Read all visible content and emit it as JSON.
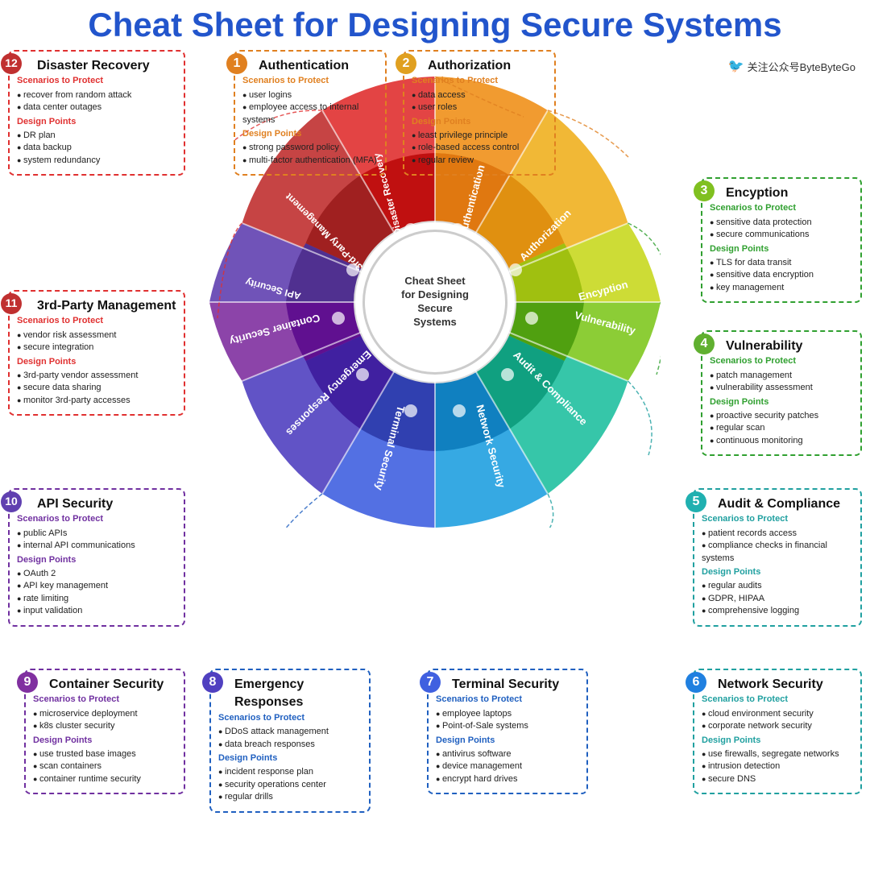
{
  "title": {
    "text": "Cheat Sheet for Designing Secure Systems",
    "brand": "关注公众号ByteByteGo"
  },
  "center": {
    "text": "Cheat Sheet\nfor Designing\nSecure\nSystems"
  },
  "sections": {
    "s1": {
      "num": "1",
      "title": "Authentication",
      "scenarios_label": "Scenarios to Protect",
      "scenarios": [
        "user logins",
        "employee access to internal systems"
      ],
      "design_label": "Design Points",
      "design": [
        "strong password policy",
        "multi-factor authentication (MFA)"
      ]
    },
    "s2": {
      "num": "2",
      "title": "Authorization",
      "scenarios_label": "Scenarios to Protect",
      "scenarios": [
        "data access",
        "user roles"
      ],
      "design_label": "Design Points",
      "design": [
        "least privilege principle",
        "role-based access control",
        "regular review"
      ]
    },
    "s3": {
      "num": "3",
      "title": "Encyption",
      "scenarios_label": "Scenarios to Protect",
      "scenarios": [
        "sensitive data protection",
        "secure communications"
      ],
      "design_label": "Design Points",
      "design": [
        "TLS for data transit",
        "sensitive data encryption",
        "key management"
      ]
    },
    "s4": {
      "num": "4",
      "title": "Vulnerability",
      "scenarios_label": "Scenarios to Protect",
      "scenarios": [
        "patch management",
        "vulnerability assessment"
      ],
      "design_label": "Design Points",
      "design": [
        "proactive security patches",
        "regular scan",
        "continuous monitoring"
      ]
    },
    "s5": {
      "num": "5",
      "title": "Audit & Compliance",
      "scenarios_label": "Scenarios to Protect",
      "scenarios": [
        "patient records access",
        "compliance checks in financial systems"
      ],
      "design_label": "Design Points",
      "design": [
        "regular audits",
        "GDPR, HIPAA",
        "comprehensive logging"
      ]
    },
    "s6": {
      "num": "6",
      "title": "Network Security",
      "scenarios_label": "Scenarios to Protect",
      "scenarios": [
        "cloud environment security",
        "corporate network security"
      ],
      "design_label": "Design Points",
      "design": [
        "use firewalls, segregate networks",
        "intrusion detection",
        "secure DNS"
      ]
    },
    "s7": {
      "num": "7",
      "title": "Terminal Security",
      "scenarios_label": "Scenarios to Protect",
      "scenarios": [
        "employee laptops",
        "Point-of-Sale systems"
      ],
      "design_label": "Design Points",
      "design": [
        "antivirus software",
        "device management",
        "encrypt hard drives"
      ]
    },
    "s8": {
      "num": "8",
      "title": "Emergency Responses",
      "scenarios_label": "Scenarios to Protect",
      "scenarios": [
        "DDoS attack management",
        "data breach responses"
      ],
      "design_label": "Design Points",
      "design": [
        "incident response plan",
        "security operations center",
        "regular drills"
      ]
    },
    "s9": {
      "num": "9",
      "title": "Container Security",
      "scenarios_label": "Scenarios to Protect",
      "scenarios": [
        "microservice deployment",
        "k8s cluster security"
      ],
      "design_label": "Design Points",
      "design": [
        "use trusted base images",
        "scan containers",
        "container runtime security"
      ]
    },
    "s10": {
      "num": "10",
      "title": "API Security",
      "scenarios_label": "Scenarios to Protect",
      "scenarios": [
        "public APIs",
        "internal API communications"
      ],
      "design_label": "Design Points",
      "design": [
        "OAuth 2",
        "API key management",
        "rate limiting",
        "input validation"
      ]
    },
    "s11": {
      "num": "11",
      "title": "3rd-Party Management",
      "scenarios_label": "Scenarios to Protect",
      "scenarios": [
        "vendor risk assessment",
        "secure integration"
      ],
      "design_label": "Design Points",
      "design": [
        "3rd-party vendor assessment",
        "secure data sharing",
        "monitor 3rd-party accesses"
      ]
    },
    "s12": {
      "num": "12",
      "title": "Disaster Recovery",
      "scenarios_label": "Scenarios to Protect",
      "scenarios": [
        "recover from random attack",
        "data center outages"
      ],
      "design_label": "Design Points",
      "design": [
        "DR plan",
        "data backup",
        "system redundancy"
      ]
    }
  }
}
